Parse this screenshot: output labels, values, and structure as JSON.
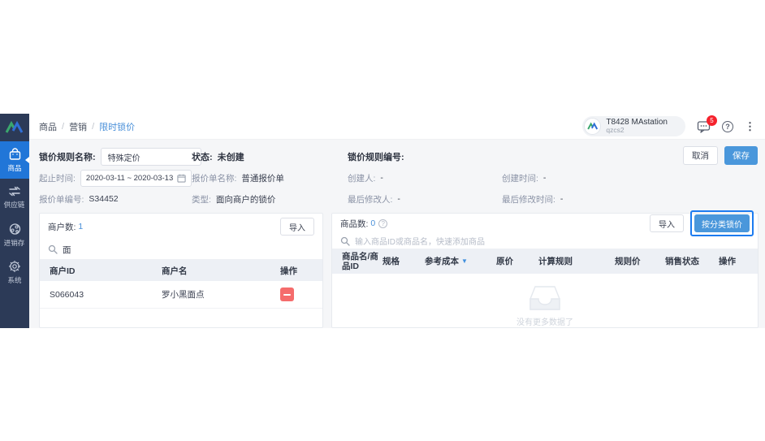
{
  "colors": {
    "accent_blue": "#4a97db",
    "link_blue": "#4a90d9",
    "sidebar_navy": "#2c3a57",
    "active_blue": "#2176d8",
    "danger_red": "#f56c6c",
    "badge_red": "#f5222d",
    "highlight_ring": "#1c7bf0"
  },
  "sidebar": {
    "items": [
      {
        "label": "商品",
        "icon": "bag-icon",
        "active": true
      },
      {
        "label": "供应链",
        "icon": "arrows-icon",
        "active": false
      },
      {
        "label": "进销存",
        "icon": "nodes-icon",
        "active": false
      },
      {
        "label": "系统",
        "icon": "gear-icon",
        "active": false
      }
    ]
  },
  "topbar": {
    "breadcrumb": [
      "商品",
      "营销",
      "限时锁价"
    ],
    "sep": "/",
    "user": {
      "name": "T8428 MAstation",
      "account": "qzcs2"
    },
    "message_badge": "5",
    "help_glyph": "?",
    "kebab_glyph": "⋮"
  },
  "form": {
    "rule_name_label": "锁价规则名称:",
    "rule_name_value": "特殊定价",
    "status_label": "状态:",
    "status_value": "未创建",
    "rule_no_label": "锁价规则编号:",
    "cancel_label": "取消",
    "save_label": "保存",
    "date_label": "起止时间:",
    "date_value": "2020-03-11 ~ 2020-03-13",
    "quote_name_label": "报价单名称:",
    "quote_name_value": "普通报价单",
    "creator_label": "创建人:",
    "creator_value": "-",
    "create_time_label": "创建时间:",
    "create_time_value": "-",
    "quote_no_label": "报价单编号:",
    "quote_no_value": "S34452",
    "type_label": "类型:",
    "type_value": "面向商户的锁价",
    "modifier_label": "最后修改人:",
    "modifier_value": "-",
    "modify_time_label": "最后修改时间:",
    "modify_time_value": "-"
  },
  "merchants": {
    "count_label": "商户数:",
    "count": "1",
    "import_label": "导入",
    "search_value": "面",
    "columns": [
      "商户ID",
      "商户名",
      "操作"
    ],
    "rows": [
      {
        "id": "S066043",
        "name": "罗小黑面点"
      }
    ]
  },
  "products": {
    "count_label": "商品数:",
    "count": "0",
    "help_glyph": "?",
    "import_label": "导入",
    "category_button_label": "按分类锁价",
    "search_placeholder": "输入商品ID或商品名，快速添加商品",
    "columns": [
      "商品名/商品ID",
      "规格",
      "参考成本",
      "原价",
      "计算规则",
      "规则价",
      "销售状态",
      "操作"
    ],
    "sort_caret": "▼",
    "empty_text": "没有更多数据了"
  }
}
